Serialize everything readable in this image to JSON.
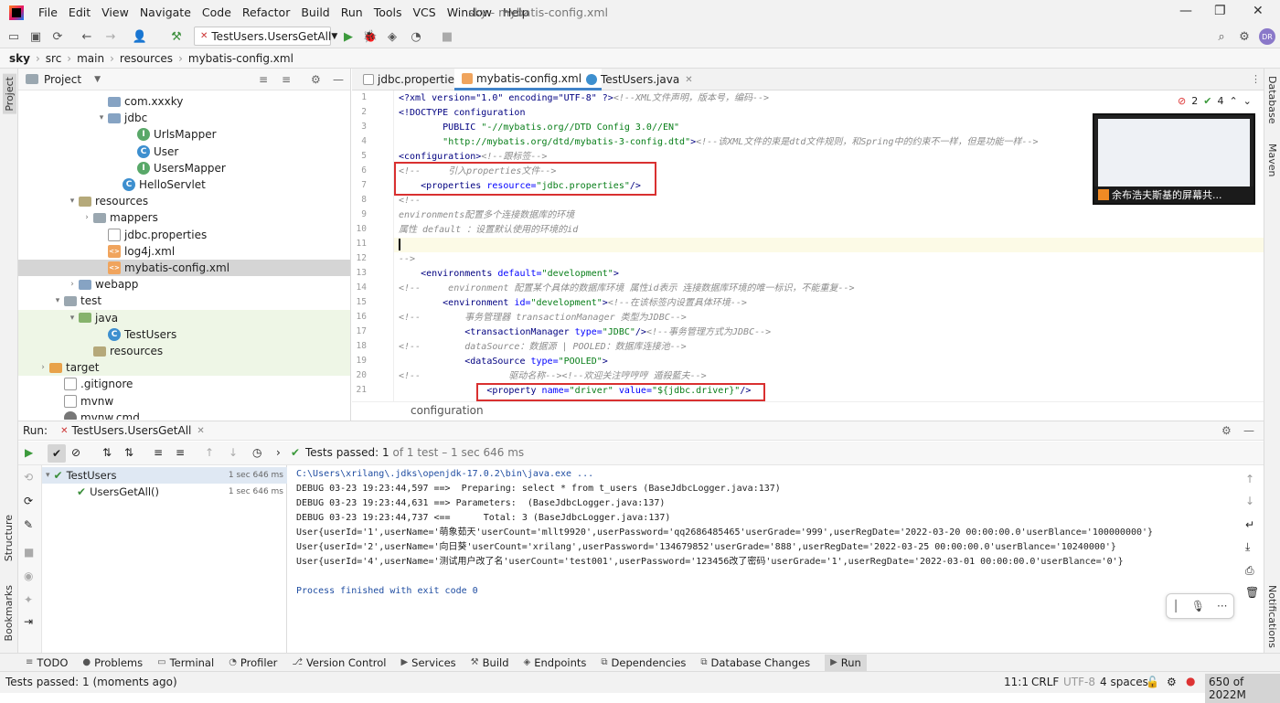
{
  "menu": [
    "File",
    "Edit",
    "View",
    "Navigate",
    "Code",
    "Refactor",
    "Build",
    "Run",
    "Tools",
    "VCS",
    "Window",
    "Help"
  ],
  "window_title": "sky - mybatis-config.xml",
  "toolbar": {
    "run_config": "TestUsers.UsersGetAll"
  },
  "breadcrumb": [
    "sky",
    "src",
    "main",
    "resources",
    "mybatis-config.xml"
  ],
  "left_strip": {
    "project": "Project",
    "structure": "Structure",
    "bookmarks": "Bookmarks"
  },
  "right_strip": {
    "database": "Database",
    "maven": "Maven",
    "notifications": "Notifications"
  },
  "project_panel": {
    "title": "Project"
  },
  "tree": [
    {
      "label": "com.xxxky",
      "indent": 5,
      "icon": "folder-blue",
      "tw": "",
      "state": ""
    },
    {
      "label": "jdbc",
      "indent": 5,
      "icon": "folder-blue",
      "tw": "▾",
      "state": ""
    },
    {
      "label": "UrlsMapper",
      "indent": 7,
      "icon": "intf",
      "tw": "",
      "state": ""
    },
    {
      "label": "User",
      "indent": 7,
      "icon": "cls",
      "tw": "",
      "state": ""
    },
    {
      "label": "UsersMapper",
      "indent": 7,
      "icon": "intf",
      "tw": "",
      "state": ""
    },
    {
      "label": "HelloServlet",
      "indent": 6,
      "icon": "cls",
      "tw": "",
      "state": ""
    },
    {
      "label": "resources",
      "indent": 3,
      "icon": "folder-res",
      "tw": "▾",
      "state": ""
    },
    {
      "label": "mappers",
      "indent": 4,
      "icon": "folder",
      "tw": "›",
      "state": ""
    },
    {
      "label": "jdbc.properties",
      "indent": 5,
      "icon": "file",
      "tw": "",
      "state": ""
    },
    {
      "label": "log4j.xml",
      "indent": 5,
      "icon": "xml",
      "tw": "",
      "state": ""
    },
    {
      "label": "mybatis-config.xml",
      "indent": 5,
      "icon": "xml",
      "tw": "",
      "state": "sel"
    },
    {
      "label": "webapp",
      "indent": 3,
      "icon": "folder-blue",
      "tw": "›",
      "state": ""
    },
    {
      "label": "test",
      "indent": 2,
      "icon": "folder",
      "tw": "▾",
      "state": ""
    },
    {
      "label": "java",
      "indent": 3,
      "icon": "folder-green",
      "tw": "▾",
      "state": "green"
    },
    {
      "label": "TestUsers",
      "indent": 5,
      "icon": "cls",
      "tw": "",
      "state": "green"
    },
    {
      "label": "resources",
      "indent": 4,
      "icon": "folder-res",
      "tw": "",
      "state": "green"
    },
    {
      "label": "target",
      "indent": 1,
      "icon": "folder-orange",
      "tw": "›",
      "state": "green"
    },
    {
      "label": ".gitignore",
      "indent": 2,
      "icon": "file",
      "tw": "",
      "state": ""
    },
    {
      "label": "mvnw",
      "indent": 2,
      "icon": "file",
      "tw": "",
      "state": ""
    },
    {
      "label": "mvnw.cmd",
      "indent": 2,
      "icon": "gear",
      "tw": "",
      "state": ""
    }
  ],
  "editor_tabs": [
    {
      "label": "jdbc.properties",
      "active": false
    },
    {
      "label": "mybatis-config.xml",
      "active": true
    },
    {
      "label": "TestUsers.java",
      "active": false
    }
  ],
  "inspections": {
    "errors": "2",
    "warnings": "4"
  },
  "code_lines": [
    [
      {
        "t": "<?xml version=\"1.0\" encoding=\"UTF-8\" ?>",
        "c": "tg"
      },
      {
        "t": "<!--XML文件声明，版本号，编码-->",
        "c": "cm"
      }
    ],
    [
      {
        "t": "<!DOCTYPE configuration",
        "c": "tg"
      }
    ],
    [
      {
        "t": "        PUBLIC ",
        "c": "tg"
      },
      {
        "t": "\"-//mybatis.org//DTD Config 3.0//EN\"",
        "c": "st"
      }
    ],
    [
      {
        "t": "        ",
        "c": ""
      },
      {
        "t": "\"http://mybatis.org/dtd/mybatis-3-config.dtd\"",
        "c": "st"
      },
      {
        "t": ">",
        "c": "tg"
      },
      {
        "t": "<!--该XML文件的束是dtd文件规则，和Spring中的约束不一样，但是功能一样-->",
        "c": "cm"
      }
    ],
    [
      {
        "t": "<configuration>",
        "c": "tg"
      },
      {
        "t": "<!--跟标签-->",
        "c": "cm"
      }
    ],
    [
      {
        "t": "<!--     引入properties文件-->",
        "c": "cm"
      }
    ],
    [
      {
        "t": "    <properties ",
        "c": "tg"
      },
      {
        "t": "resource=",
        "c": "at"
      },
      {
        "t": "\"jdbc.properties\"",
        "c": "st"
      },
      {
        "t": "/>",
        "c": "tg"
      }
    ],
    [
      {
        "t": "<!--",
        "c": "cm"
      }
    ],
    [
      {
        "t": "environments配置多个连接数据库的环境",
        "c": "cm"
      }
    ],
    [
      {
        "t": "属性 default ：设置默认使用的环境的id",
        "c": "cm"
      }
    ],
    [
      {
        "t": "",
        "c": ""
      }
    ],
    [
      {
        "t": "-->",
        "c": "cm"
      }
    ],
    [
      {
        "t": "    <environments ",
        "c": "tg"
      },
      {
        "t": "default=",
        "c": "at"
      },
      {
        "t": "\"development\"",
        "c": "st"
      },
      {
        "t": ">",
        "c": "tg"
      }
    ],
    [
      {
        "t": "<!--     environment 配置某个具体的数据库环境 属性id表示 连接数据库环境的唯一标识，不能重复-->",
        "c": "cm"
      }
    ],
    [
      {
        "t": "        <environment ",
        "c": "tg"
      },
      {
        "t": "id=",
        "c": "at"
      },
      {
        "t": "\"development\"",
        "c": "st"
      },
      {
        "t": ">",
        "c": "tg"
      },
      {
        "t": "<!--在该标签内设置具体环境-->",
        "c": "cm"
      }
    ],
    [
      {
        "t": "<!--        事务管理器 transactionManager 类型为JDBC-->",
        "c": "cm"
      }
    ],
    [
      {
        "t": "            <transactionManager ",
        "c": "tg"
      },
      {
        "t": "type=",
        "c": "at"
      },
      {
        "t": "\"JDBC\"",
        "c": "st"
      },
      {
        "t": "/>",
        "c": "tg"
      },
      {
        "t": "<!--事务管理方式为JDBC-->",
        "c": "cm"
      }
    ],
    [
      {
        "t": "<!--        dataSource：数据源 | POOLED：数据库连接池-->",
        "c": "cm"
      }
    ],
    [
      {
        "t": "            <dataSource ",
        "c": "tg"
      },
      {
        "t": "type=",
        "c": "at"
      },
      {
        "t": "\"POOLED\"",
        "c": "st"
      },
      {
        "t": ">",
        "c": "tg"
      }
    ],
    [
      {
        "t": "<!--                驱动名称--><!--欢迎关注哼哼哼 遁殺藍夫-->",
        "c": "cm"
      }
    ],
    [
      {
        "t": "                <property ",
        "c": "tg"
      },
      {
        "t": "name=",
        "c": "at"
      },
      {
        "t": "\"driver\"",
        "c": "st"
      },
      {
        "t": " value=",
        "c": "at"
      },
      {
        "t": "\"${jdbc.driver}\"",
        "c": "st"
      },
      {
        "t": "/>",
        "c": "tg"
      }
    ]
  ],
  "code_footer": "configuration",
  "screen_share": "余布浩夫斯基的屏幕共...",
  "run": {
    "label": "Run:",
    "tab": "TestUsers.UsersGetAll",
    "status_prefix": "Tests passed:",
    "status_count": "1",
    "status_suffix": "of 1 test – 1 sec 646 ms"
  },
  "test_tree": [
    {
      "label": "TestUsers",
      "time": "1 sec 646 ms",
      "indent": 0
    },
    {
      "label": "UsersGetAll()",
      "time": "1 sec 646 ms",
      "indent": 1
    }
  ],
  "console": [
    {
      "t": "C:\\Users\\xrilang\\.jdks\\openjdk-17.0.2\\bin\\java.exe ...",
      "c": "blue"
    },
    {
      "t": "DEBUG 03-23 19:23:44,597 ==>  Preparing: select * from t_users (BaseJdbcLogger.java:137)",
      "c": ""
    },
    {
      "t": "DEBUG 03-23 19:23:44,631 ==> Parameters:  (BaseJdbcLogger.java:137)",
      "c": ""
    },
    {
      "t": "DEBUG 03-23 19:23:44,737 <==      Total: 3 (BaseJdbcLogger.java:137)",
      "c": ""
    },
    {
      "t": "User{userId='1',userName='萌象茹天'userCount='mllt9920',userPassword='qq2686485465'userGrade='999',userRegDate='2022-03-20 00:00:00.0'userBlance='100000000'}",
      "c": ""
    },
    {
      "t": "User{userId='2',userName='向日葵'userCount='xrilang',userPassword='134679852'userGrade='888',userRegDate='2022-03-25 00:00:00.0'userBlance='10240000'}",
      "c": ""
    },
    {
      "t": "User{userId='4',userName='测试用户改了名'userCount='test001',userPassword='123456改了密码'userGrade='1',userRegDate='2022-03-01 00:00:00.0'userBlance='0'}",
      "c": ""
    },
    {
      "t": "",
      "c": ""
    },
    {
      "t": "Process finished with exit code 0",
      "c": "blue"
    }
  ],
  "bottom_tabs": [
    "TODO",
    "Problems",
    "Terminal",
    "Profiler",
    "Version Control",
    "Services",
    "Build",
    "Endpoints",
    "Dependencies",
    "Database Changes",
    "Run"
  ],
  "status": {
    "left": "Tests passed: 1 (moments ago)",
    "position": "11:1",
    "line_sep": "CRLF",
    "encoding": "UTF-8",
    "indent": "4 spaces",
    "memory": "650 of 2022M"
  }
}
